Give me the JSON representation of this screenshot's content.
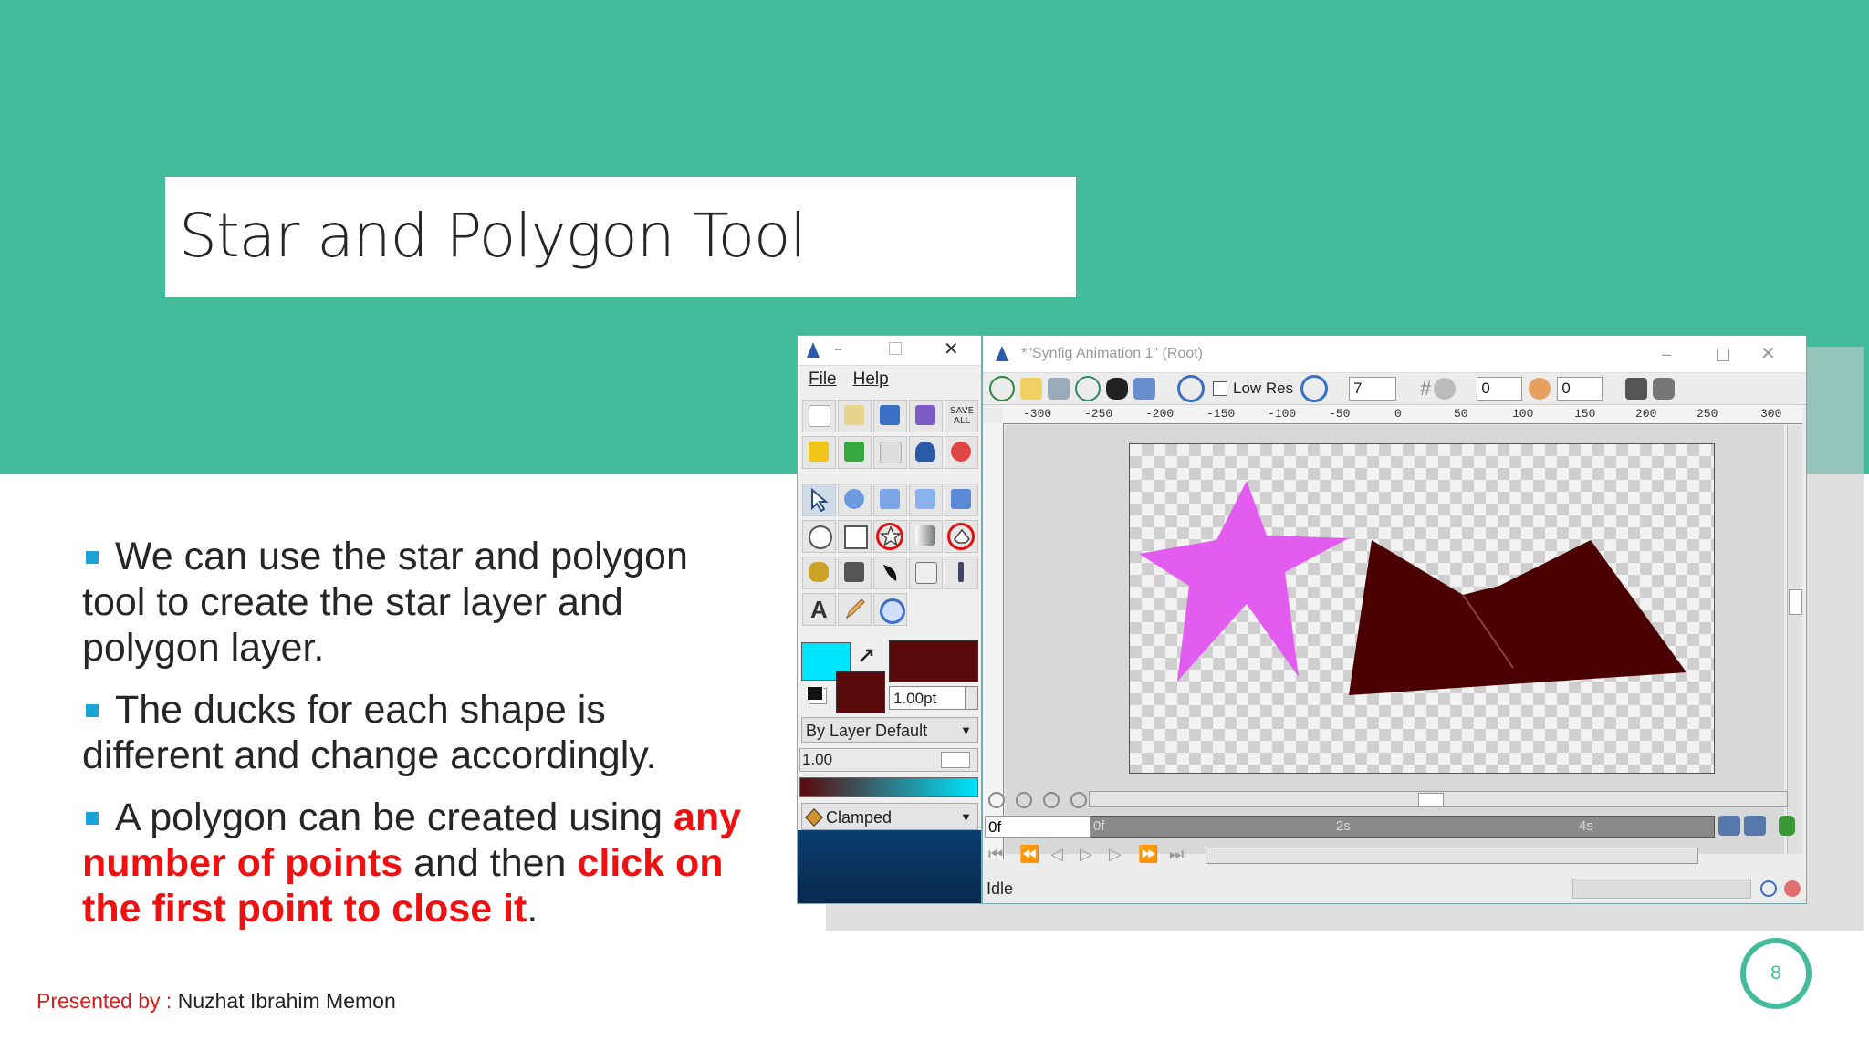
{
  "slide": {
    "title": "Star and Polygon Tool",
    "page_number": "8",
    "footer_label": "Presented by : ",
    "footer_author": "Nuzhat Ibrahim Memon",
    "colors": {
      "banner": "#44bb9b",
      "bullet": "#1aa3d6",
      "highlight": "#ee1111"
    }
  },
  "bullets": [
    {
      "text": "We can use the star and polygon tool to create the star layer and polygon layer."
    },
    {
      "text": "The ducks for each shape is different and change accordingly."
    },
    {
      "pre": "A polygon can be created using ",
      "red1": "any number of points",
      "mid": " and then ",
      "red2": "click on the first point to close it",
      "post": "."
    }
  ],
  "toolbox": {
    "menu": [
      "File",
      "Help"
    ],
    "save_all": "SAVE ALL",
    "outline_color": "#5a0a0a",
    "fill_color": "#00e5ff",
    "width_value": "1.00pt",
    "blend_method": "By Layer Default",
    "opacity_value": "1.00",
    "interpolation": "Clamped"
  },
  "canvas_window": {
    "title": "*\"Synfig Animation 1\" (Root)",
    "low_res_label": "Low Res",
    "field_1": "7",
    "field_2": "0",
    "field_3": "0",
    "ruler_labels": [
      "-300",
      "-250",
      "-200",
      "-150",
      "-100",
      "-50",
      "0",
      "50",
      "100",
      "150",
      "200",
      "250",
      "300"
    ],
    "current_time": "0f",
    "time_marks": [
      "0f",
      "2s",
      "4s"
    ],
    "status": "Idle",
    "star_color": "#e25cf0",
    "polygon_color": "#4a0000"
  }
}
